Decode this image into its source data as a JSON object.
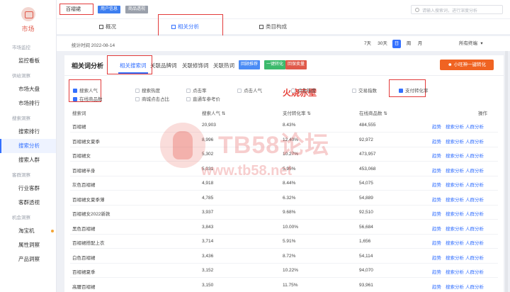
{
  "sidebar": {
    "brand_label": "市场",
    "sections": [
      {
        "title": "市场监控",
        "items": [
          {
            "label": "监控看板",
            "active": false
          }
        ]
      },
      {
        "title": "供给洞察",
        "items": [
          {
            "label": "市场大盘",
            "active": false
          },
          {
            "label": "市场排行",
            "active": false
          }
        ]
      },
      {
        "title": "搜索洞察",
        "items": [
          {
            "label": "搜索排行",
            "active": false
          },
          {
            "label": "搜索分析",
            "active": true
          },
          {
            "label": "搜索人群",
            "active": false
          }
        ]
      },
      {
        "title": "客群洞察",
        "items": [
          {
            "label": "行业客群",
            "active": false
          },
          {
            "label": "客群透视",
            "active": false
          }
        ]
      },
      {
        "title": "机会洞察",
        "items": [
          {
            "label": "淘宝机",
            "active": false
          },
          {
            "label": "属性洞察",
            "active": false
          },
          {
            "label": "产品洞察",
            "active": false
          }
        ]
      }
    ]
  },
  "header": {
    "keyword": "百褶裙",
    "tag_user": "用户信息",
    "tag_product": "商品透视",
    "search_placeholder": "请输入搜索词，进行深度分析"
  },
  "tabs": [
    "概况",
    "相关分析",
    "类目构成"
  ],
  "datebar": {
    "stat_date": "统计时间 2022-08-14",
    "ranges": [
      "7天",
      "30天",
      "日",
      "周",
      "月"
    ],
    "active_range": "日",
    "device": "所有终端"
  },
  "panel": {
    "title": "相关词分析",
    "subtabs": [
      "相关搜索词",
      "关联品牌词",
      "关联修饰词",
      "关联热词"
    ],
    "tag_buttons": [
      "回顾推荐",
      "一键转化",
      "回保卖量"
    ],
    "orange_button": "小旺神一键转化",
    "red_text": "火烧赤壁",
    "checkboxes": [
      {
        "label": "搜索人气",
        "checked": true
      },
      {
        "label": "搜索热度",
        "checked": false
      },
      {
        "label": "点击率",
        "checked": false
      },
      {
        "label": "点击人气",
        "checked": false
      },
      {
        "label": "点击热度",
        "checked": false
      },
      {
        "label": "交易指数",
        "checked": false
      },
      {
        "label": "支付转化率",
        "checked": true
      },
      {
        "label": "在线商品数",
        "checked": true
      },
      {
        "label": "商城点击占比",
        "checked": false
      },
      {
        "label": "直通车参考价",
        "checked": false
      }
    ],
    "columns": [
      "搜索词",
      "搜索人气",
      "支付转化率",
      "在线商品数",
      "操作"
    ],
    "actions": [
      "趋势",
      "搜索分析",
      "人群分析"
    ],
    "rows": [
      {
        "word": "百褶裙",
        "pop": "20,903",
        "rate": "8.43%",
        "items": "484,555"
      },
      {
        "word": "百褶裙女夏季",
        "pop": "8,996",
        "rate": "12.40%",
        "items": "92,972"
      },
      {
        "word": "百褶裙女",
        "pop": "5,302",
        "rate": "10.27%",
        "items": "473,957"
      },
      {
        "word": "百褶裙半身",
        "pop": "5,031",
        "rate": "5.95%",
        "items": "453,068"
      },
      {
        "word": "灰色百褶裙",
        "pop": "4,918",
        "rate": "8.44%",
        "items": "54,075"
      },
      {
        "word": "百褶裙女夏季薄",
        "pop": "4,785",
        "rate": "6.32%",
        "items": "54,889"
      },
      {
        "word": "百褶裙女2022新款",
        "pop": "3,937",
        "rate": "9.68%",
        "items": "92,510"
      },
      {
        "word": "黑色百褶裙",
        "pop": "3,843",
        "rate": "10.00%",
        "items": "56,684"
      },
      {
        "word": "百褶裙搭配上衣",
        "pop": "3,714",
        "rate": "5.91%",
        "items": "1,656"
      },
      {
        "word": "白色百褶裙",
        "pop": "3,436",
        "rate": "8.72%",
        "items": "54,114"
      },
      {
        "word": "百褶裙夏季",
        "pop": "3,152",
        "rate": "10.22%",
        "items": "94,070"
      },
      {
        "word": "高腰百褶裙",
        "pop": "3,150",
        "rate": "11.75%",
        "items": "93,961"
      }
    ]
  },
  "watermark": {
    "line1": "TB58论坛",
    "line2": "www.tb58.net"
  }
}
